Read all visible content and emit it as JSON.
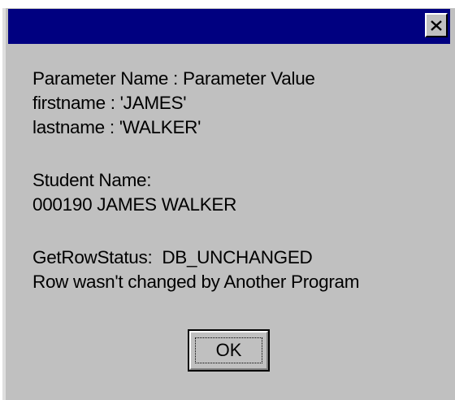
{
  "dialog": {
    "title": "",
    "close_icon": "close-x-icon",
    "lines_group1": [
      "Parameter Name : Parameter Value",
      "firstname : 'JAMES'",
      "lastname : 'WALKER'"
    ],
    "lines_group2": [
      "Student Name:",
      "000190 JAMES WALKER"
    ],
    "lines_group3": [
      "GetRowStatus:  DB_UNCHANGED",
      "Row wasn't changed by Another Program"
    ],
    "ok_label": "OK"
  },
  "colors": {
    "titlebar": "#000080",
    "face": "#c0c0c0"
  }
}
